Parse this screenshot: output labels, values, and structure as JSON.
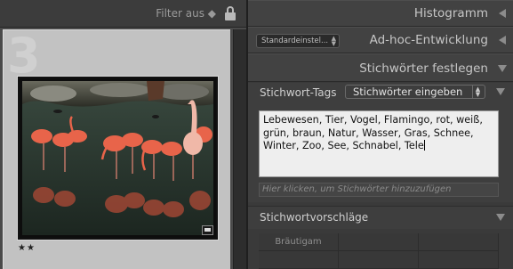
{
  "filter_bar": {
    "label": "Filter aus ◆"
  },
  "grid": {
    "cell_number": "3",
    "rating_stars": "★★",
    "rating_value": 2
  },
  "panels": {
    "histogram": {
      "title": "Histogramm"
    },
    "quick_develop": {
      "title": "Ad-hoc-Entwicklung",
      "preset_value": "Standardeinstel..."
    },
    "keywording": {
      "title": "Stichwörter festlegen",
      "tags_label": "Stichwort-Tags",
      "tags_mode": "Stichwörter eingeben",
      "keywords_text": "Lebewesen, Tier, Vogel, Flamingo, rot, weiß, grün, braun, Natur, Wasser, Gras, Schnee, Winter, Zoo, See, Schnabel, Tele",
      "hint_placeholder": "Hier klicken, um Stichwörter hinzuzufügen"
    },
    "suggestions": {
      "title": "Stichwortvorschläge",
      "items": [
        "Bräutigam",
        "",
        "",
        "",
        "",
        ""
      ]
    }
  },
  "colors": {
    "background": "#3a3a3a",
    "cell": "#c2c2c2",
    "textarea": "#eeeeee"
  },
  "icons": [
    "lock-icon",
    "collapse-left-icon",
    "collapse-down-icon",
    "comment-badge-icon"
  ]
}
